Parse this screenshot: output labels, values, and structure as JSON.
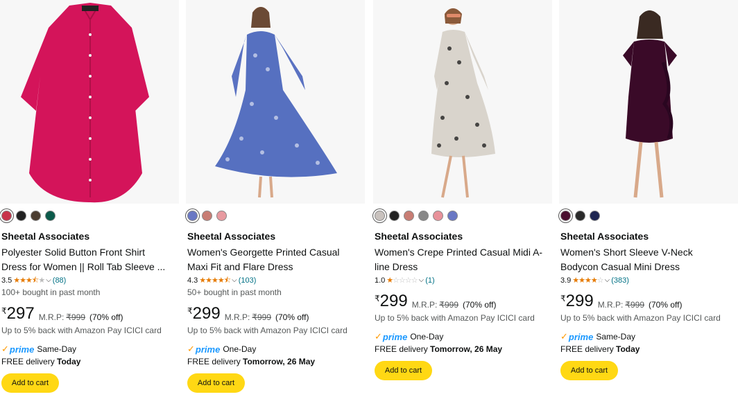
{
  "products": [
    {
      "brand": "Sheetal Associates",
      "title_line1": "Polyester Solid Button Front Shirt",
      "title_line2": "Dress for Women || Roll Tab Sleeve ...",
      "rating": "3.5",
      "stars": "3.5 of 5",
      "review_count": "(88)",
      "bought": "100+ bought in past month",
      "currency": "₹",
      "price": "297",
      "mrp_label": "M.R.P:",
      "mrp": "₹999",
      "discount": "(70% off)",
      "cashback": "Up to 5% back with Amazon Pay ICICI card",
      "prime_label": "prime",
      "delivery_speed": "Same-Day",
      "delivery_prefix": "FREE delivery",
      "delivery_date": "Today",
      "cart_label": "Add to cart",
      "swatches": [
        "#c8334a",
        "#222222",
        "#4a3c30",
        "#0b5a4a"
      ],
      "dress_color": "#d4145a"
    },
    {
      "brand": "Sheetal Associates",
      "title_line1": "Women's Georgette Printed Casual",
      "title_line2": "Maxi Fit and Flare Dress",
      "rating": "4.3",
      "stars": "4.3 of 5",
      "review_count": "(103)",
      "bought": "50+ bought in past month",
      "currency": "₹",
      "price": "299",
      "mrp_label": "M.R.P:",
      "mrp": "₹999",
      "discount": "(70% off)",
      "cashback": "Up to 5% back with Amazon Pay ICICI card",
      "prime_label": "prime",
      "delivery_speed": "One-Day",
      "delivery_prefix": "FREE delivery",
      "delivery_date": "Tomorrow, 26 May",
      "cart_label": "Add to cart",
      "swatches": [
        "#6a78c4",
        "#c87d74",
        "#e89aa0"
      ],
      "dress_color": "#5670c0"
    },
    {
      "brand": "Sheetal Associates",
      "title_line1": "Women's Crepe Printed Casual Midi A-",
      "title_line2": "line Dress",
      "rating": "1.0",
      "stars": "1 of 5",
      "review_count": "(1)",
      "currency": "₹",
      "price": "299",
      "mrp_label": "M.R.P:",
      "mrp": "₹999",
      "discount": "(70% off)",
      "cashback": "Up to 5% back with Amazon Pay ICICI card",
      "prime_label": "prime",
      "delivery_speed": "One-Day",
      "delivery_prefix": "FREE delivery",
      "delivery_date": "Tomorrow, 26 May",
      "cart_label": "Add to cart",
      "swatches": [
        "#c9c2be",
        "#222222",
        "#c87d74",
        "#888888",
        "#e8929a",
        "#6a78c4"
      ],
      "dress_color": "#d9d4cc"
    },
    {
      "brand": "Sheetal Associates",
      "title_line1": "Women's Short Sleeve V-Neck",
      "title_line2": "Bodycon Casual Mini Dress",
      "rating": "3.9",
      "stars": "3.9 of 5",
      "review_count": "(383)",
      "currency": "₹",
      "price": "299",
      "mrp_label": "M.R.P:",
      "mrp": "₹999",
      "discount": "(70% off)",
      "cashback": "Up to 5% back with Amazon Pay ICICI card",
      "prime_label": "prime",
      "delivery_speed": "Same-Day",
      "delivery_prefix": "FREE delivery",
      "delivery_date": "Today",
      "cart_label": "Add to cart",
      "swatches": [
        "#4a1030",
        "#2a2a2a",
        "#1e2550"
      ],
      "dress_color": "#3a0a28"
    }
  ]
}
